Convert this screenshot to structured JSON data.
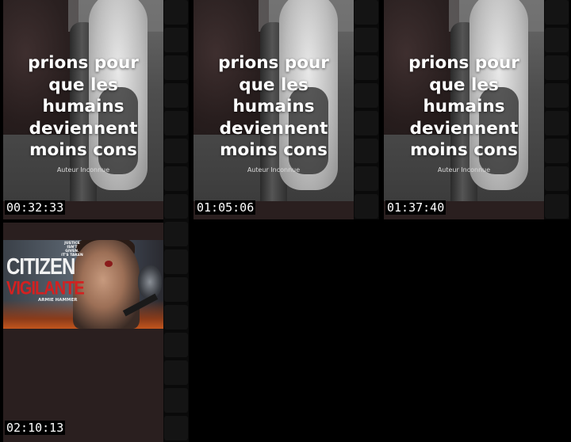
{
  "quote_poster": {
    "lines": [
      "prions pour",
      "que les",
      "humains",
      "deviennent",
      "moins cons"
    ],
    "author": "Auteur Inconnue"
  },
  "movie_poster": {
    "tagline_1": "JUSTICE ISN'T GIVEN.",
    "tagline_2": "IT'S TAKEN",
    "title_1": "CITIZEN",
    "title_2": "VIGILANTE",
    "actor": "ARMIE HAMMER"
  },
  "thumbnails": [
    {
      "timestamp": "00:32:33"
    },
    {
      "timestamp": "01:05:06"
    },
    {
      "timestamp": "01:37:40"
    },
    {
      "timestamp": "02:10:13"
    }
  ],
  "colors": {
    "background": "#000000",
    "thumb_bg": "#2a1f1f",
    "title_red": "#d42020"
  }
}
